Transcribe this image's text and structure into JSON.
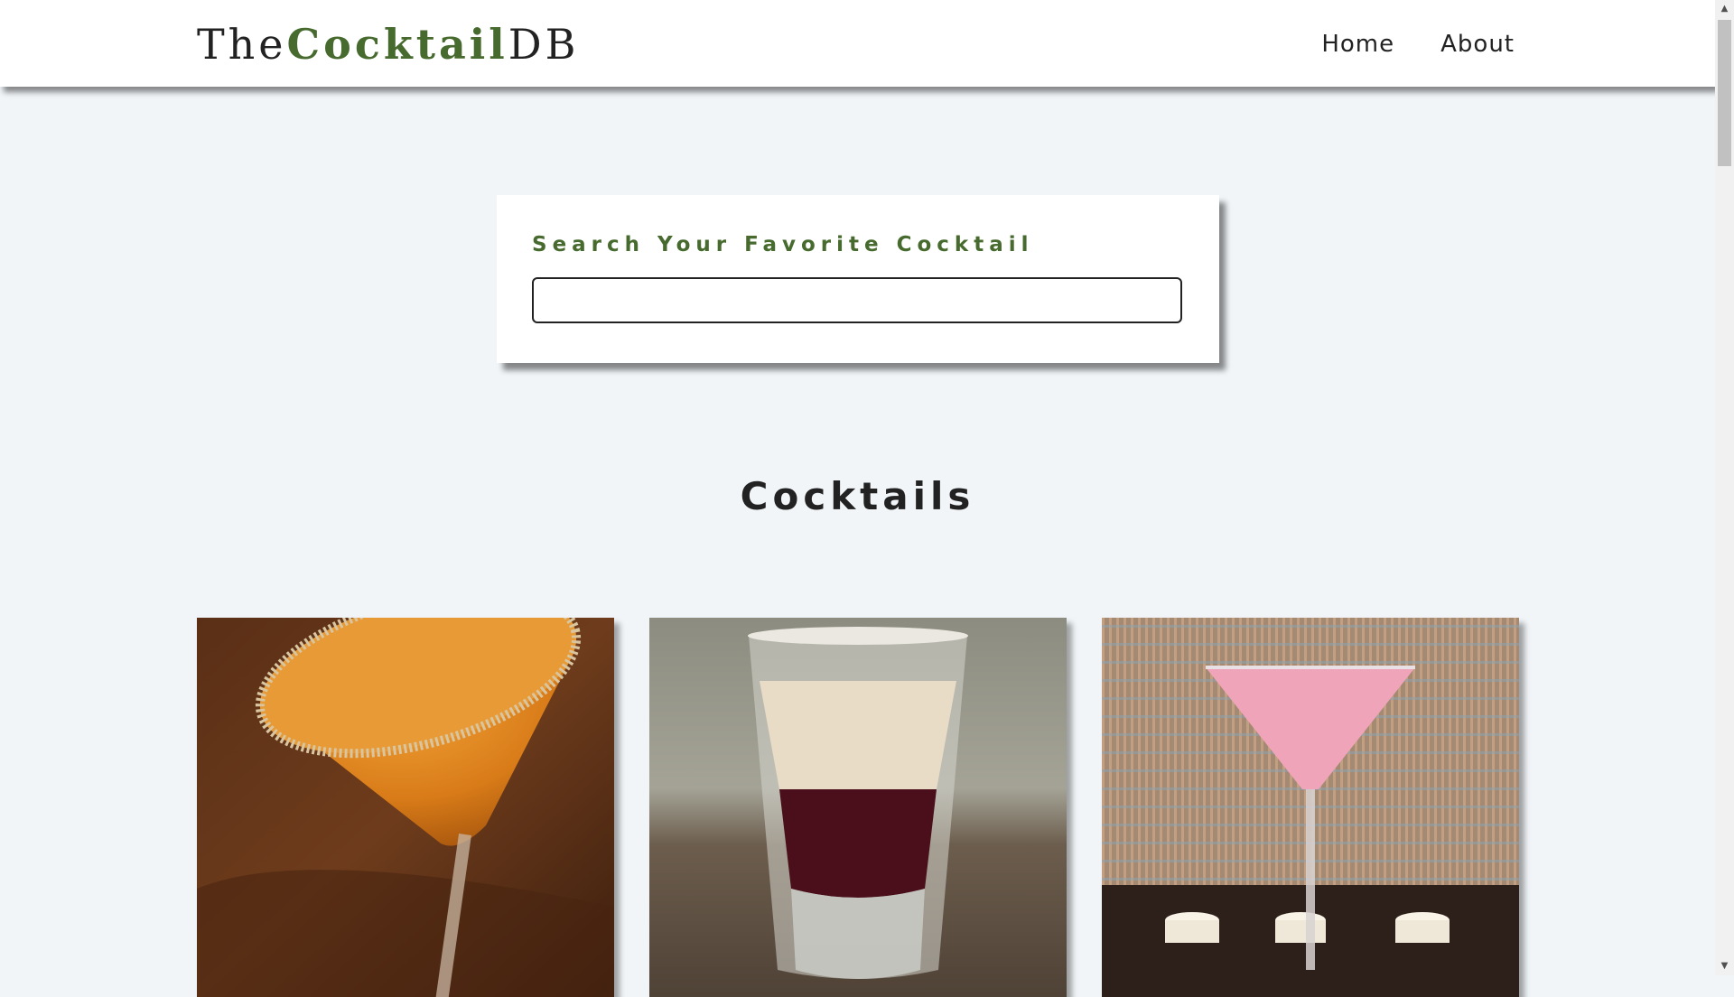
{
  "navbar": {
    "logo": {
      "prefix": "The",
      "brand": "Cocktail",
      "suffix": "DB"
    },
    "links": [
      {
        "label": "Home"
      },
      {
        "label": "About"
      }
    ]
  },
  "search": {
    "label": "Search Your Favorite Cocktail",
    "value": ""
  },
  "section": {
    "title": "Cocktails"
  },
  "colors": {
    "accent": "#476a2e",
    "background": "#f1f5f8",
    "text": "#222222"
  },
  "cocktails": [
    {
      "image": "orange-martini-sugar-rim"
    },
    {
      "image": "layered-shot-glass"
    },
    {
      "image": "pink-martini-candles"
    }
  ]
}
